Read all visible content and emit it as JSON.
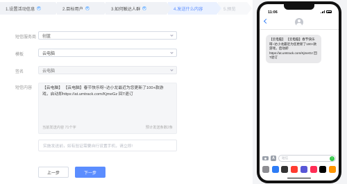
{
  "steps": [
    {
      "label": "1.设置活动信息",
      "state": "done"
    },
    {
      "label": "2.目标用户",
      "state": "done"
    },
    {
      "label": "3.如何触达人群",
      "state": "done"
    },
    {
      "label": "4.发送什么内容",
      "state": "active"
    },
    {
      "label": "5.预览",
      "state": "future"
    }
  ],
  "form": {
    "provider_label": "短信服务商",
    "provider_value": "创蓝",
    "template_label": "模板",
    "template_value": "云电脑",
    "signature_label": "签名",
    "signature_value": "云电脑",
    "content_label": "短信内容",
    "content_text": "【云电脑】 【云电脑】春节快乐呀~达小龙最近为您更新了100+款游戏，启动即https://at.umtrack.com/KjmeGz 回T退订",
    "char_count": "当前发送内容 71个字",
    "estimate": "预计发送条数2条",
    "test_placeholder": "实施发送前，如有验证需要自行设置手机，请立即!"
  },
  "buttons": {
    "prev": "上一步",
    "next": "下一步"
  },
  "phone": {
    "time": "11:06",
    "message": "【云电脑】 【云电脑】春节快乐呀~达小龙最近为您更新了100+款游戏，启动即https://at.umtrack.com/KjmeGz 回T退订",
    "input_placeholder": "短信"
  },
  "colors": {
    "accent": "#5b8dff",
    "step_active_bg": "#eaf1ff",
    "send_green": "#36c94b",
    "dock": [
      "#8e8e93",
      "#2d7cf6",
      "#333333",
      "#ff3b30",
      "#5856d6",
      "#ff2d55",
      "#000000",
      "#ff9500"
    ]
  }
}
